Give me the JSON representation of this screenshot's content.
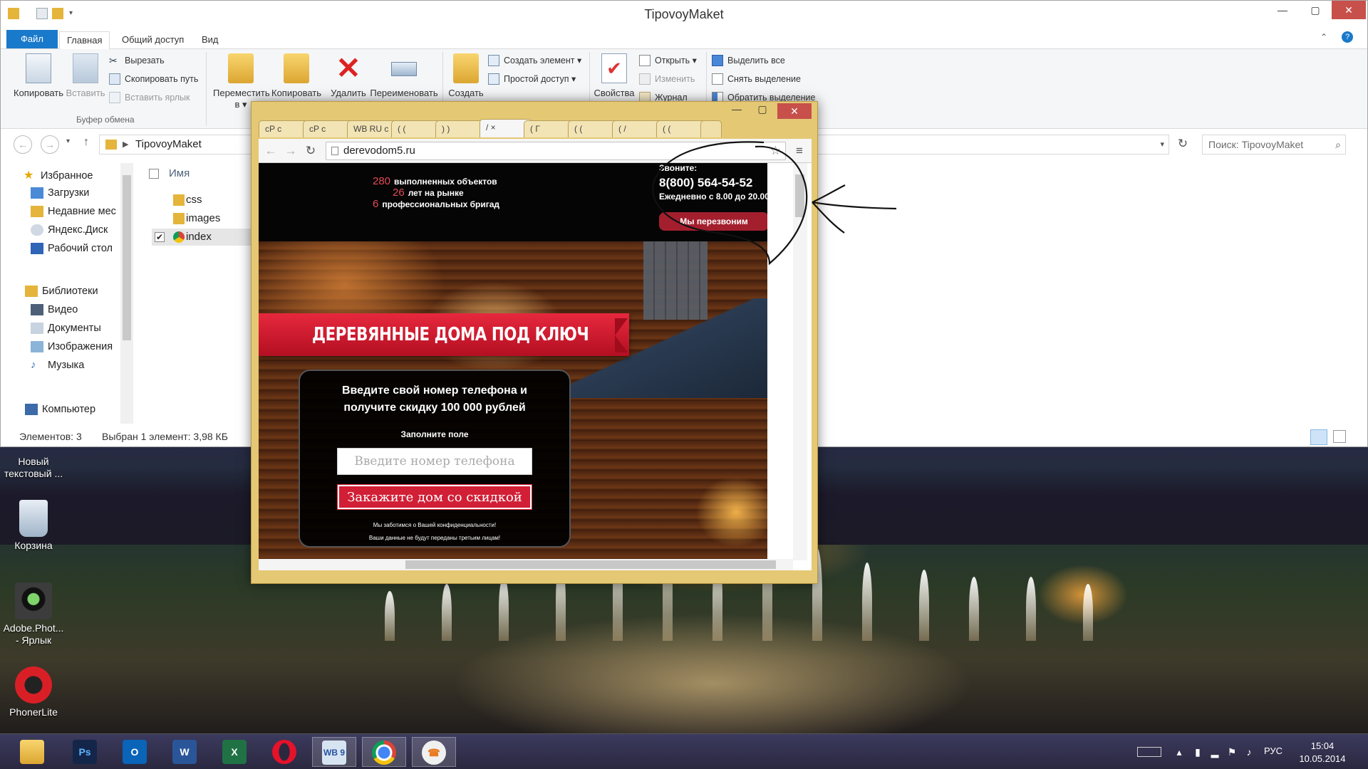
{
  "explorer": {
    "title": "TipovoyMaket",
    "menu_tabs": [
      "Файл",
      "Главная",
      "Общий доступ",
      "Вид"
    ],
    "ribbon": {
      "copy": "Копировать",
      "paste": "Вставить",
      "cut": "Вырезать",
      "copy_path": "Скопировать путь",
      "paste_shortcut": "Вставить ярлык",
      "clipboard_group": "Буфер обмена",
      "move_to": "Переместить в ▾",
      "copy_to": "Копировать в ▾",
      "delete": "Удалить",
      "rename": "Переименовать",
      "new_folder": "Создать папку",
      "new_item": "Создать элемент ▾",
      "easy_access": "Простой доступ ▾",
      "properties": "Свойства",
      "open": "Открыть ▾",
      "edit": "Изменить",
      "history": "Журнал",
      "select_all": "Выделить все",
      "select_none": "Снять выделение",
      "invert_selection": "Обратить выделение"
    },
    "address": "TipovoyMaket",
    "search_placeholder": "Поиск: TipovoyMaket",
    "nav": {
      "favorites": "Избранное",
      "downloads": "Загрузки",
      "recent": "Недавние мес",
      "yandex_disk": "Яндекс.Диск",
      "desktop": "Рабочий стол",
      "libraries": "Библиотеки",
      "video": "Видео",
      "documents": "Документы",
      "images": "Изображения",
      "music": "Музыка",
      "computer": "Компьютер"
    },
    "column_name": "Имя",
    "files": [
      "css",
      "images",
      "index"
    ],
    "status_count": "Элементов: 3",
    "status_selected": "Выбран 1 элемент: 3,98 КБ"
  },
  "desktop_icons": {
    "new_text": "Новый текстовый ...",
    "recycle_bin": "Корзина",
    "photoshop": "Adobe.Phot... - Ярлык",
    "phonerlite": "PhonerLite"
  },
  "chrome": {
    "tabs": [
      "cP c",
      "cP c",
      "WB RU c",
      "( (",
      ") )",
      "/ ×",
      "( Г",
      "( (",
      "( /",
      "( ("
    ],
    "url": "derevodom5.ru"
  },
  "site": {
    "stats": [
      {
        "num": "280",
        "text": "выполненных объектов"
      },
      {
        "num": "26",
        "text": "лет на рынке"
      },
      {
        "num": "6",
        "text": "профессиональных бригад"
      }
    ],
    "call_label": "Звоните:",
    "phone": "8(800) 564-54-52",
    "hours": "Ежедневно с 8.00 до 20.00",
    "callback_button": "Мы перезвоним",
    "headline": "ДЕРЕВЯННЫЕ ДОМА ПОД КЛЮЧ",
    "form_title": "Введите свой номер телефона и получите скидку 100 000 рублей",
    "form_label": "Заполните поле",
    "phone_placeholder": "Введите номер телефона",
    "order_button": "Закажите дом со скидкой",
    "privacy_1": "Мы заботимся о Вашей конфиденциальности!",
    "privacy_2": "Ваши данные не будут переданы третьим лицам!"
  },
  "taskbar": {
    "wb_label": "WB 9",
    "lang": "РУС",
    "time": "15:04",
    "date": "10.05.2014"
  },
  "colors": {
    "accent_red": "#d11f36",
    "file_tab_blue": "#1979ca",
    "chrome_frame": "#e4c873"
  }
}
